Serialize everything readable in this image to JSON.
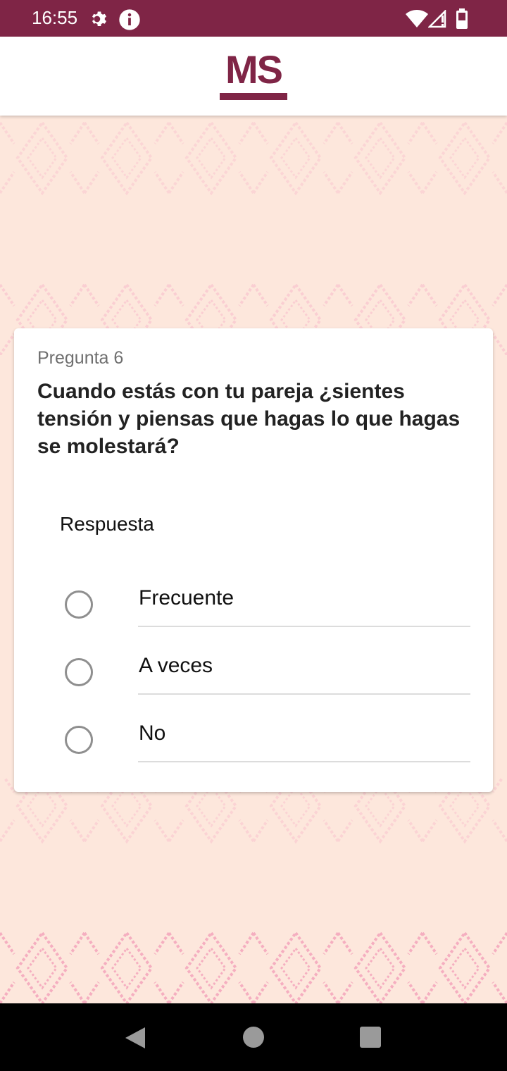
{
  "status_bar": {
    "time": "16:55"
  },
  "header": {
    "logo_text": "MS"
  },
  "question": {
    "number_label": "Pregunta 6",
    "text": "Cuando estás con tu pareja ¿sientes tensión y piensas que hagas lo que hagas se molestará?",
    "answer_label": "Respuesta",
    "options": [
      {
        "label": "Frecuente",
        "selected": false
      },
      {
        "label": "A veces",
        "selected": false
      },
      {
        "label": "No",
        "selected": false
      }
    ]
  },
  "colors": {
    "brand": "#7f2546",
    "background": "#fde7dc",
    "pattern": "#f7c1cc"
  }
}
